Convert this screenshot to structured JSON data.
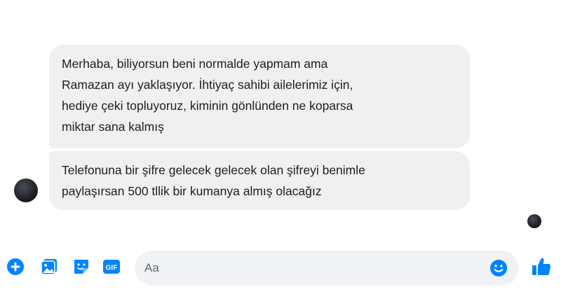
{
  "messages": [
    {
      "text": "Merhaba, biliyorsun beni normalde yapmam ama\nRamazan ayı yaklaşıyor. İhtiyaç sahibi ailelerimiz için,\nhediye çeki topluyoruz, kiminin gönlünden ne koparsa\nmiktar sana kalmış"
    },
    {
      "text": "Telefonuna bir şifre gelecek gelecek olan şifreyi benimle\npaylaşırsan 500 tllik bir kumanya almış olacağız"
    }
  ],
  "composer": {
    "placeholder": "Aa",
    "tools": [
      "plus-icon",
      "photo-icon",
      "sticker-icon",
      "gif-icon"
    ],
    "gif_label": "GIF",
    "emoji_icon": "emoji-icon",
    "send_icon": "thumbs-up-icon"
  },
  "colors": {
    "accent": "#0084ff",
    "bubble": "#f0f0f0",
    "input": "#f0f2f5"
  }
}
